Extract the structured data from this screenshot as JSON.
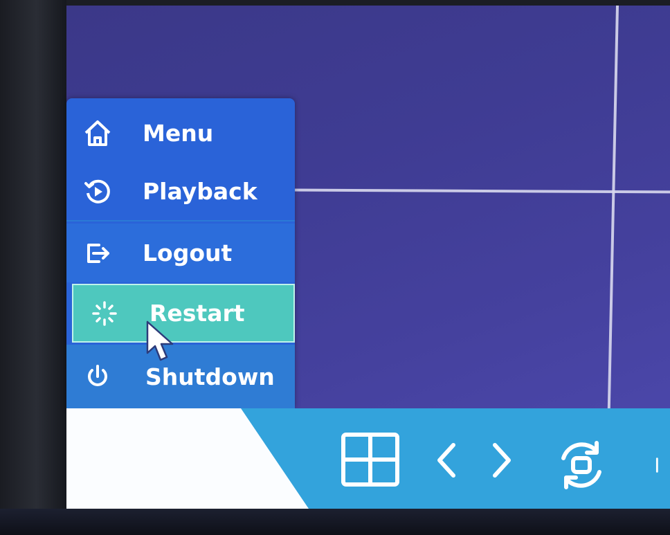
{
  "menu": {
    "items": [
      {
        "label": "Menu",
        "icon": "home-icon"
      },
      {
        "label": "Playback",
        "icon": "playback-icon"
      },
      {
        "label": "Logout",
        "icon": "logout-icon"
      },
      {
        "label": "Restart",
        "icon": "restart-icon"
      },
      {
        "label": "Shutdown",
        "icon": "power-icon"
      }
    ],
    "highlighted": "Restart"
  },
  "taskbar": {
    "icons": [
      "layout-grid-icon",
      "previous-icon",
      "next-icon",
      "rotate-view-icon",
      "more-icon"
    ]
  },
  "colors": {
    "menu_bg": "#2a63d8",
    "highlight": "#4ec8be",
    "taskbar": "#33a3dc",
    "screen_bg": "#3f3c93"
  }
}
